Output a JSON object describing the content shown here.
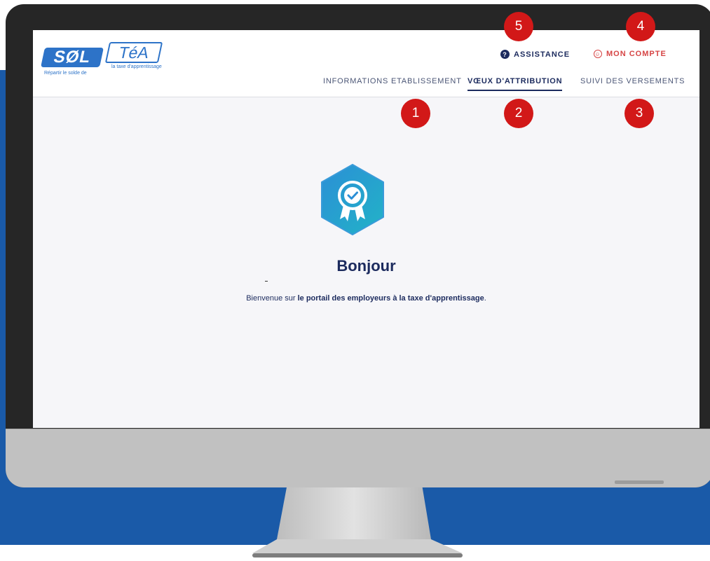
{
  "colors": {
    "band": "#1a5aa8",
    "navy": "#1c2b5e",
    "accent_red": "#d64545",
    "marker_red": "#d21818",
    "logo_blue": "#2d73c8"
  },
  "logo": {
    "sol": "SØL",
    "tea": "TéA",
    "sub_left": "Répartir le solde de",
    "sub_right": "la taxe d'apprentissage"
  },
  "header": {
    "assistance": {
      "label": "ASSISTANCE",
      "icon": "help-circle-icon"
    },
    "account": {
      "label": "MON COMPTE",
      "icon": "user-circle-icon"
    }
  },
  "nav": {
    "tabs": [
      {
        "label": "INFORMATIONS ETABLISSEMENT",
        "active": false
      },
      {
        "label": "VŒUX D'ATTRIBUTION",
        "active": true
      },
      {
        "label": "SUIVI DES VERSEMENTS",
        "active": false
      }
    ]
  },
  "main": {
    "badge_icon": "award-badge-icon",
    "greeting": "Bonjour",
    "welcome_prefix": "Bienvenue sur ",
    "welcome_bold": "le portail des employeurs à la taxe d'apprentissage",
    "welcome_suffix": "."
  },
  "markers": [
    "1",
    "2",
    "3",
    "4",
    "5"
  ]
}
